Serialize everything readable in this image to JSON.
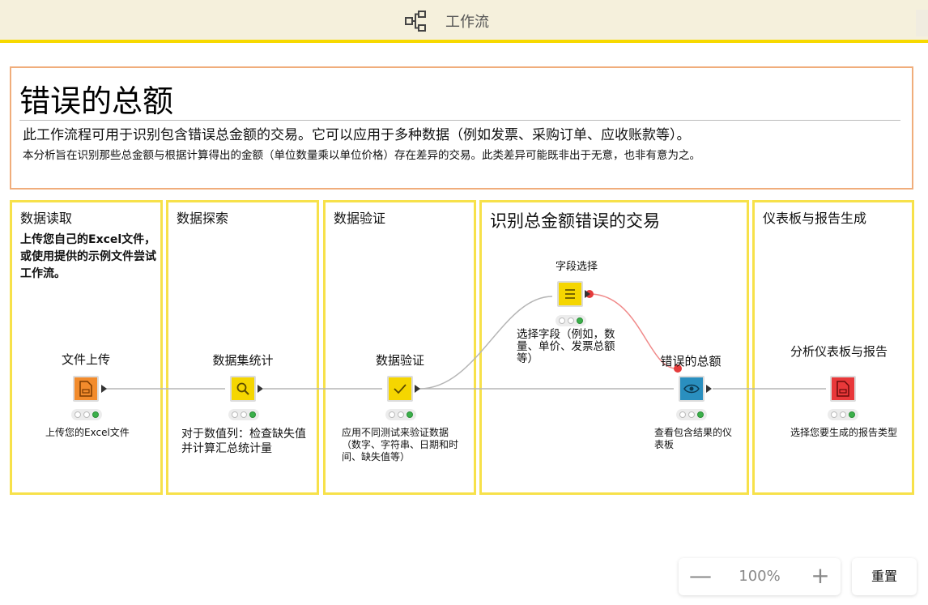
{
  "header": {
    "title": "工作流",
    "icon": "workflow-icon"
  },
  "annotation": {
    "title": "错误的总额",
    "line1": "此工作流程可用于识别包含错误总金额的交易。它可以应用于多种数据（例如发票、采购订单、应收账款等）。",
    "line2": "本分析旨在识别那些总金额与根据计算得出的金额（单位数量乘以单位价格）存在差异的交易。此类差异可能既非出于无意，也非有意为之。"
  },
  "sections": [
    {
      "title": "数据读取",
      "desc": "上传您自己的Excel文件，或使用提供的示例文件尝试工作流。"
    },
    {
      "title": "数据探索"
    },
    {
      "title": "数据验证"
    },
    {
      "title": "识别总金额错误的交易"
    },
    {
      "title": "仪表板与报告生成"
    }
  ],
  "nodes": [
    {
      "label": "文件上传",
      "desc": "上传您的Excel文件",
      "color": "#f28b2c",
      "icon": "file-upload-icon"
    },
    {
      "label": "数据集统计",
      "desc": "对于数值列：检查缺失值并计算汇总统计量",
      "color": "#f5d600",
      "icon": "search-icon"
    },
    {
      "label": "数据验证",
      "desc": "应用不同测试来验证数据（数字、字符串、日期和时间、缺失值等）",
      "color": "#f5d600",
      "icon": "checkmark-icon"
    },
    {
      "label": "字段选择",
      "desc": "选择字段（例如，数量、单价、发票总额等）",
      "color": "#f5d600",
      "icon": "list-icon"
    },
    {
      "label": "错误的总额",
      "desc": "查看包含结果的仪表板",
      "color": "#2a8fbf",
      "icon": "eye-icon"
    },
    {
      "label": "分析仪表板与报告",
      "desc": "选择您要生成的报告类型",
      "color": "#e8383a",
      "icon": "report-icon"
    }
  ],
  "zoom": {
    "minus": "—",
    "value": "100%",
    "plus": "+",
    "reset": "重置"
  }
}
